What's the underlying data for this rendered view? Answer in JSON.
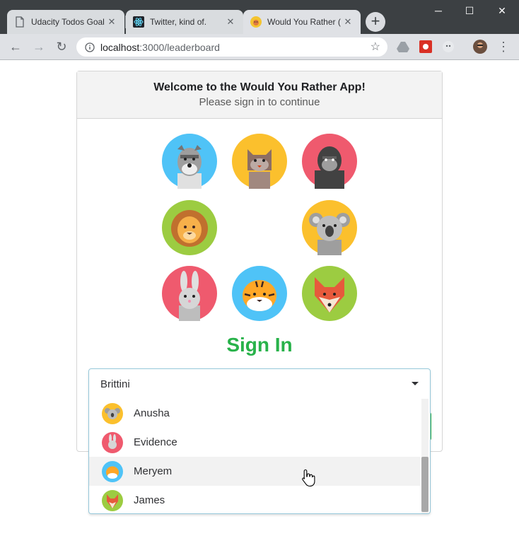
{
  "browser": {
    "tabs": [
      {
        "title": "Udacity Todos Goal",
        "icon": "document-icon",
        "active": false
      },
      {
        "title": "Twitter, kind of.",
        "icon": "react-icon",
        "active": false
      },
      {
        "title": "Would You Rather (",
        "icon": "app-avatar-icon",
        "active": true
      }
    ],
    "new_tab_label": "+",
    "window_controls": {
      "minimize": "─",
      "maximize": "☐",
      "close": "✕"
    },
    "nav": {
      "back": "←",
      "forward": "→",
      "reload": "↻"
    },
    "url_host": "localhost",
    "url_path": ":3000/leaderboard",
    "star_icon": "☆",
    "menu_icon": "⋮"
  },
  "page": {
    "welcome_title": "Welcome to the Would You Rather App!",
    "welcome_subtitle": "Please sign in to continue",
    "avatars": [
      "schnauzer-icon",
      "cat-icon",
      "gorilla-icon",
      "lion-icon",
      "koala-icon",
      "rabbit-icon",
      "tiger-icon",
      "fox-icon"
    ],
    "signin_title": "Sign In",
    "dropdown": {
      "selected": "Brittini",
      "options": [
        {
          "name": "Anusha",
          "avatar": "koala-icon"
        },
        {
          "name": "Evidence",
          "avatar": "rabbit-icon"
        },
        {
          "name": "Meryem",
          "avatar": "tiger-icon",
          "hovered": true
        },
        {
          "name": "James",
          "avatar": "fox-icon"
        }
      ]
    }
  },
  "colors": {
    "signin_green": "#28b24a",
    "dropdown_border": "#96c8da",
    "chrome_dark": "#3c4043"
  }
}
